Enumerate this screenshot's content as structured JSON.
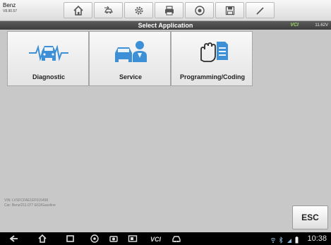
{
  "vehicle": {
    "make": "Benz",
    "version": "V8.90.57"
  },
  "toolbar": {
    "buttons": [
      {
        "icon": "home-icon"
      },
      {
        "icon": "vehicle-swap-icon"
      },
      {
        "icon": "gear-icon"
      },
      {
        "icon": "printer-icon"
      },
      {
        "icon": "help-icon"
      },
      {
        "icon": "save-icon"
      },
      {
        "icon": "pen-icon"
      }
    ]
  },
  "titlebar": {
    "title": "Select Application",
    "vci_label": "VCI",
    "voltage": "11.62V"
  },
  "tiles": [
    {
      "label": "Diagnostic",
      "icon": "car-diagnostic-icon"
    },
    {
      "label": "Service",
      "icon": "car-service-icon"
    },
    {
      "label": "Programming/Coding",
      "icon": "hand-document-icon"
    }
  ],
  "info": {
    "vin": "VIN: LVSFCFAE1EF015498",
    "car": "Car: Benz/211.077 E63/Gasoline"
  },
  "esc_label": "ESC",
  "navbar": {
    "icons": [
      "back-icon",
      "home-icon",
      "recent-apps-icon",
      "browser-icon",
      "camera-icon",
      "screen-capture-icon",
      "vci-icon",
      "car-icon"
    ],
    "time": "10:38"
  },
  "colors": {
    "accent_green": "#9ed46a",
    "title_bg": "#4a4a4a",
    "body_bg": "#c8c8c8"
  }
}
